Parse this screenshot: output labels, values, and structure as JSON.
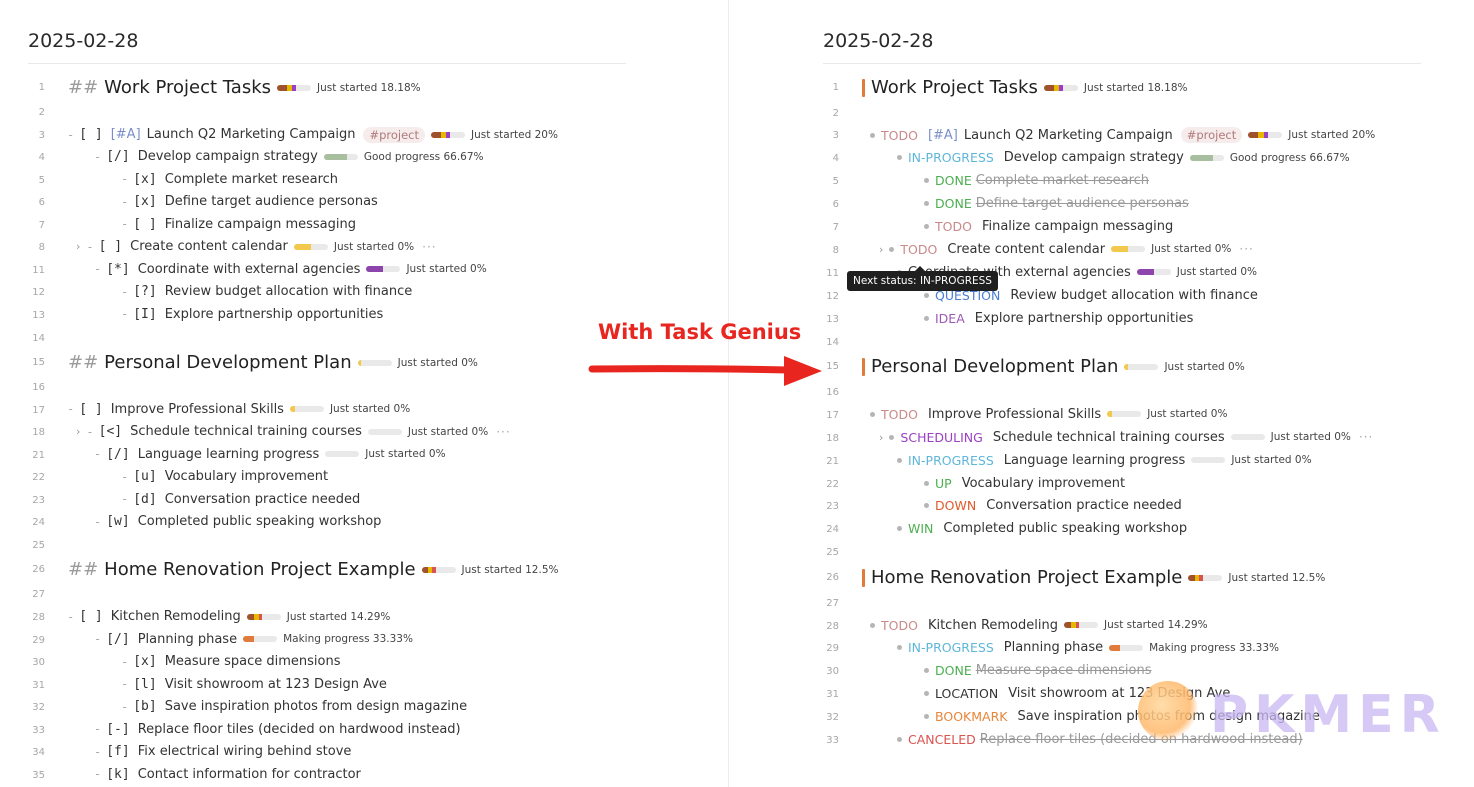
{
  "date": "2025-02-28",
  "callout": "With Task Genius",
  "tooltip": "Next status: IN-PROGRESS",
  "watermark": "PKMER",
  "colors": {
    "arrow": "#e8261f",
    "heading_accent": "#e07b39",
    "status_TODO": "#c98a8a",
    "status_IN-PROGRESS": "#5fb6d9",
    "status_DONE": "#4caf50",
    "status_QUESTION": "#4a7fd4",
    "status_IDEA": "#9b59b6",
    "status_SCHEDULING": "#9b3fc4",
    "status_UP": "#4caf50",
    "status_DOWN": "#e05a2b",
    "status_WIN": "#4caf50",
    "status_LOCATION": "#333333",
    "status_BOOKMARK": "#e8863a",
    "status_CANCELED": "#d9534f"
  },
  "left_lines": [
    {
      "n": "1",
      "kind": "h",
      "text": "Work Project Tasks",
      "bar": [
        [
          "#a0522d",
          0.3
        ],
        [
          "#e6b800",
          0.15
        ],
        [
          "#9b3fc4",
          0.1
        ]
      ],
      "ptext": "Just started 18.18%"
    },
    {
      "n": "2",
      "kind": "blank"
    },
    {
      "n": "3",
      "kind": "t",
      "indent": 0,
      "chk": "[ ]",
      "prio": "[#A]",
      "text": "Launch Q2 Marketing Campaign",
      "tag": "#project",
      "bar": [
        [
          "#a0522d",
          0.3
        ],
        [
          "#e6b800",
          0.15
        ],
        [
          "#9b3fc4",
          0.12
        ]
      ],
      "ptext": "Just started 20%"
    },
    {
      "n": "4",
      "kind": "t",
      "indent": 1,
      "chk": "[/]",
      "text": "Develop campaign strategy",
      "bar": [
        [
          "#a8bf9f",
          0.67
        ]
      ],
      "ptext": "Good progress 66.67%"
    },
    {
      "n": "5",
      "kind": "t",
      "indent": 2,
      "chk": "[x]",
      "text": "Complete market research"
    },
    {
      "n": "6",
      "kind": "t",
      "indent": 2,
      "chk": "[x]",
      "text": "Define target audience personas"
    },
    {
      "n": "7",
      "kind": "t",
      "indent": 2,
      "chk": "[ ]",
      "text": "Finalize campaign messaging"
    },
    {
      "n": "8",
      "kind": "t",
      "indent": 1,
      "chev": true,
      "chk": "[ ]",
      "text": "Create content calendar",
      "bar": [
        [
          "#f2c94c",
          0.5
        ]
      ],
      "ptext": "Just started 0%",
      "more": true
    },
    {
      "n": "11",
      "kind": "t",
      "indent": 1,
      "chk": "[*]",
      "text": "Coordinate with external agencies",
      "bar": [
        [
          "#8e44ad",
          0.5
        ]
      ],
      "ptext": "Just started 0%"
    },
    {
      "n": "12",
      "kind": "t",
      "indent": 2,
      "chk": "[?]",
      "text": "Review budget allocation with finance"
    },
    {
      "n": "13",
      "kind": "t",
      "indent": 2,
      "chk": "[I]",
      "text": "Explore partnership opportunities"
    },
    {
      "n": "14",
      "kind": "blank"
    },
    {
      "n": "15",
      "kind": "h",
      "text": "Personal Development Plan",
      "bar": [
        [
          "#f2c94c",
          0.1
        ]
      ],
      "ptext": "Just started 0%"
    },
    {
      "n": "16",
      "kind": "blank"
    },
    {
      "n": "17",
      "kind": "t",
      "indent": 0,
      "chk": "[ ]",
      "text": "Improve Professional Skills",
      "bar": [
        [
          "#f2c94c",
          0.15
        ]
      ],
      "ptext": "Just started 0%"
    },
    {
      "n": "18",
      "kind": "t",
      "indent": 1,
      "chev": true,
      "chk": "[<]",
      "text": "Schedule technical training courses",
      "bar": [],
      "ptext": "Just started 0%",
      "more": true
    },
    {
      "n": "21",
      "kind": "t",
      "indent": 1,
      "chk": "[/]",
      "text": "Language learning progress",
      "bar": [],
      "ptext": "Just started 0%"
    },
    {
      "n": "22",
      "kind": "t",
      "indent": 2,
      "chk": "[u]",
      "text": "Vocabulary improvement"
    },
    {
      "n": "23",
      "kind": "t",
      "indent": 2,
      "chk": "[d]",
      "text": "Conversation practice needed"
    },
    {
      "n": "24",
      "kind": "t",
      "indent": 1,
      "chk": "[w]",
      "text": "Completed public speaking workshop"
    },
    {
      "n": "25",
      "kind": "blank"
    },
    {
      "n": "26",
      "kind": "h",
      "text": "Home Renovation Project Example",
      "bar": [
        [
          "#a0522d",
          0.2
        ],
        [
          "#e6b800",
          0.12
        ],
        [
          "#d9534f",
          0.1
        ]
      ],
      "ptext": "Just started 12.5%"
    },
    {
      "n": "27",
      "kind": "blank"
    },
    {
      "n": "28",
      "kind": "t",
      "indent": 0,
      "chk": "[ ]",
      "text": "Kitchen Remodeling",
      "bar": [
        [
          "#a0522d",
          0.2
        ],
        [
          "#e6b800",
          0.15
        ],
        [
          "#d9534f",
          0.1
        ]
      ],
      "ptext": "Just started 14.29%"
    },
    {
      "n": "29",
      "kind": "t",
      "indent": 1,
      "chk": "[/]",
      "text": "Planning phase",
      "bar": [
        [
          "#e07b39",
          0.33
        ]
      ],
      "ptext": "Making progress 33.33%"
    },
    {
      "n": "30",
      "kind": "t",
      "indent": 2,
      "chk": "[x]",
      "text": "Measure space dimensions"
    },
    {
      "n": "31",
      "kind": "t",
      "indent": 2,
      "chk": "[l]",
      "text": "Visit showroom at 123 Design Ave"
    },
    {
      "n": "32",
      "kind": "t",
      "indent": 2,
      "chk": "[b]",
      "text": "Save inspiration photos from design magazine"
    },
    {
      "n": "33",
      "kind": "t",
      "indent": 1,
      "chk": "[-]",
      "text": "Replace floor tiles (decided on hardwood instead)"
    },
    {
      "n": "34",
      "kind": "t",
      "indent": 1,
      "chk": "[f]",
      "text": "Fix electrical wiring behind stove"
    },
    {
      "n": "35",
      "kind": "t",
      "indent": 1,
      "chk": "[k]",
      "text": "Contact information for contractor"
    }
  ],
  "right_lines": [
    {
      "n": "1",
      "kind": "h",
      "text": "Work Project Tasks",
      "bar": [
        [
          "#a0522d",
          0.3
        ],
        [
          "#e6b800",
          0.15
        ],
        [
          "#9b3fc4",
          0.1
        ]
      ],
      "ptext": "Just started 18.18%"
    },
    {
      "n": "2",
      "kind": "blank"
    },
    {
      "n": "3",
      "kind": "t",
      "indent": 0,
      "st": "TODO",
      "prio": "[#A]",
      "text": "Launch Q2 Marketing Campaign",
      "tag": "#project",
      "bar": [
        [
          "#a0522d",
          0.3
        ],
        [
          "#e6b800",
          0.15
        ],
        [
          "#9b3fc4",
          0.12
        ]
      ],
      "ptext": "Just started 20%"
    },
    {
      "n": "4",
      "kind": "t",
      "indent": 1,
      "st": "IN-PROGRESS",
      "text": "Develop campaign strategy",
      "bar": [
        [
          "#a8bf9f",
          0.67
        ]
      ],
      "ptext": "Good progress 66.67%"
    },
    {
      "n": "5",
      "kind": "t",
      "indent": 2,
      "st": "DONE",
      "text": "Complete market research",
      "strike": true
    },
    {
      "n": "6",
      "kind": "t",
      "indent": 2,
      "st": "DONE",
      "text": "Define target audience personas",
      "strike": true
    },
    {
      "n": "7",
      "kind": "t",
      "indent": 2,
      "st": "TODO",
      "text": "Finalize campaign messaging"
    },
    {
      "n": "8",
      "kind": "t",
      "indent": 1,
      "chev": true,
      "st": "TODO",
      "text": "Create content calendar",
      "bar": [
        [
          "#f2c94c",
          0.5
        ]
      ],
      "ptext": "Just started 0%",
      "more": true
    },
    {
      "n": "11",
      "kind": "t",
      "indent": 1,
      "st": "",
      "text": "Coordinate with external agencies",
      "bar": [
        [
          "#8e44ad",
          0.5
        ]
      ],
      "ptext": "Just started 0%"
    },
    {
      "n": "12",
      "kind": "t",
      "indent": 2,
      "st": "QUESTION",
      "text": "Review budget allocation with finance"
    },
    {
      "n": "13",
      "kind": "t",
      "indent": 2,
      "st": "IDEA",
      "text": "Explore partnership opportunities"
    },
    {
      "n": "14",
      "kind": "blank"
    },
    {
      "n": "15",
      "kind": "h",
      "text": "Personal Development Plan",
      "bar": [
        [
          "#f2c94c",
          0.1
        ]
      ],
      "ptext": "Just started 0%"
    },
    {
      "n": "16",
      "kind": "blank"
    },
    {
      "n": "17",
      "kind": "t",
      "indent": 0,
      "st": "TODO",
      "text": "Improve Professional Skills",
      "bar": [
        [
          "#f2c94c",
          0.15
        ]
      ],
      "ptext": "Just started 0%"
    },
    {
      "n": "18",
      "kind": "t",
      "indent": 1,
      "chev": true,
      "st": "SCHEDULING",
      "text": "Schedule technical training courses",
      "bar": [],
      "ptext": "Just started 0%",
      "more": true
    },
    {
      "n": "21",
      "kind": "t",
      "indent": 1,
      "st": "IN-PROGRESS",
      "text": "Language learning progress",
      "bar": [],
      "ptext": "Just started 0%"
    },
    {
      "n": "22",
      "kind": "t",
      "indent": 2,
      "st": "UP",
      "text": "Vocabulary improvement"
    },
    {
      "n": "23",
      "kind": "t",
      "indent": 2,
      "st": "DOWN",
      "text": "Conversation practice needed"
    },
    {
      "n": "24",
      "kind": "t",
      "indent": 1,
      "st": "WIN",
      "text": "Completed public speaking workshop"
    },
    {
      "n": "25",
      "kind": "blank"
    },
    {
      "n": "26",
      "kind": "h",
      "text": "Home Renovation Project Example",
      "bar": [
        [
          "#a0522d",
          0.2
        ],
        [
          "#e6b800",
          0.12
        ],
        [
          "#d9534f",
          0.1
        ]
      ],
      "ptext": "Just started 12.5%"
    },
    {
      "n": "27",
      "kind": "blank"
    },
    {
      "n": "28",
      "kind": "t",
      "indent": 0,
      "st": "TODO",
      "text": "Kitchen Remodeling",
      "bar": [
        [
          "#a0522d",
          0.2
        ],
        [
          "#e6b800",
          0.15
        ],
        [
          "#d9534f",
          0.1
        ]
      ],
      "ptext": "Just started 14.29%"
    },
    {
      "n": "29",
      "kind": "t",
      "indent": 1,
      "st": "IN-PROGRESS",
      "text": "Planning phase",
      "bar": [
        [
          "#e07b39",
          0.33
        ]
      ],
      "ptext": "Making progress 33.33%"
    },
    {
      "n": "30",
      "kind": "t",
      "indent": 2,
      "st": "DONE",
      "text": "Measure space dimensions",
      "strike": true
    },
    {
      "n": "31",
      "kind": "t",
      "indent": 2,
      "st": "LOCATION",
      "text": "Visit showroom at 123 Design Ave"
    },
    {
      "n": "32",
      "kind": "t",
      "indent": 2,
      "st": "BOOKMARK",
      "text": "Save inspiration photos from design magazine"
    },
    {
      "n": "33",
      "kind": "t",
      "indent": 1,
      "st": "CANCELED",
      "text": "Replace floor tiles (decided on hardwood instead)",
      "strike": true
    }
  ]
}
